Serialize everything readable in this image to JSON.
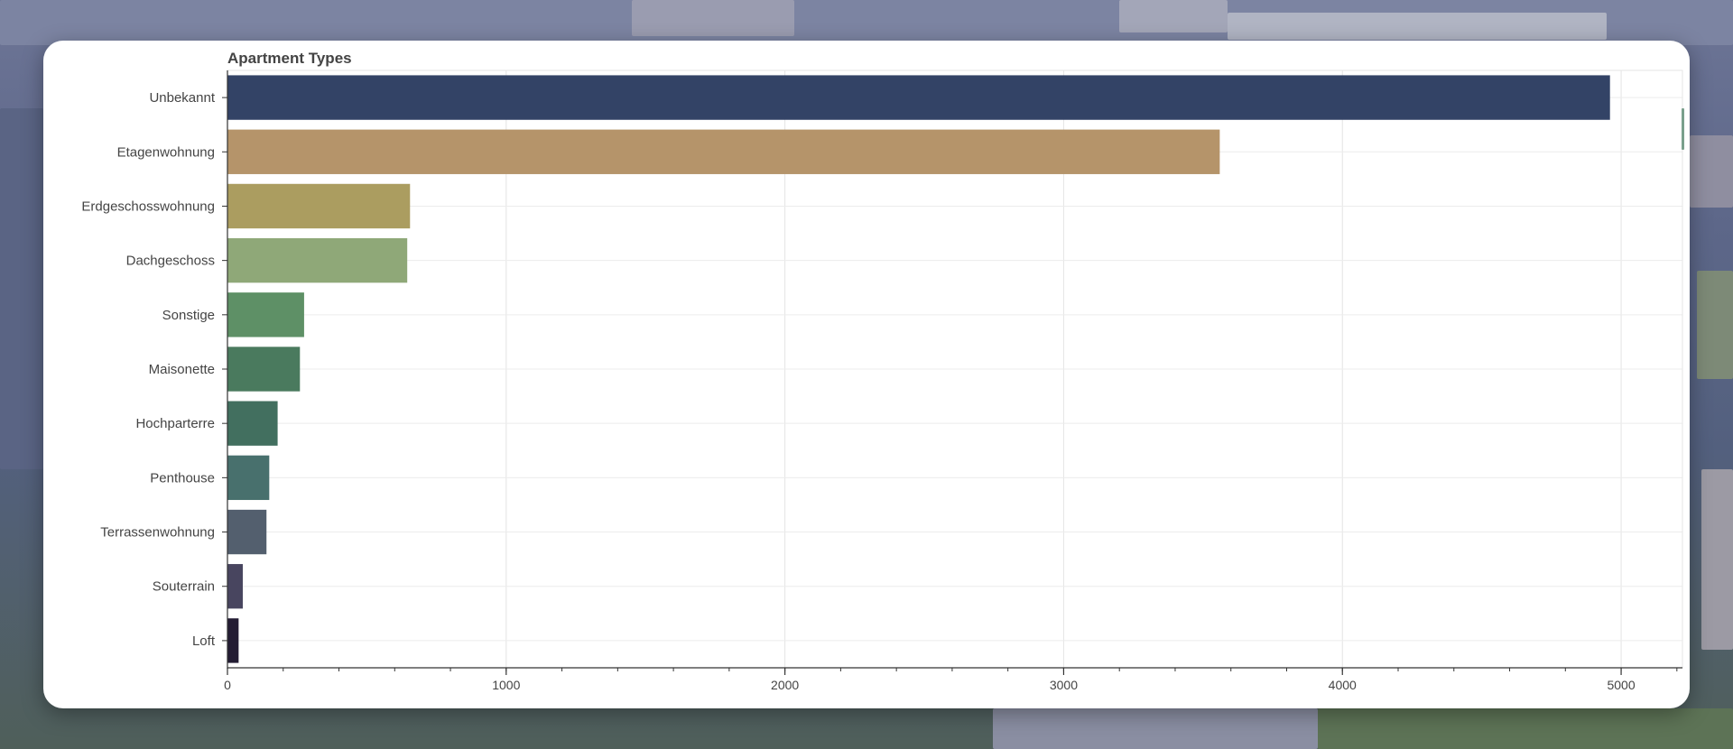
{
  "chart_data": {
    "type": "bar",
    "orientation": "horizontal",
    "title": "Apartment Types",
    "xlabel": "",
    "ylabel": "",
    "categories": [
      "Unbekannt",
      "Etagenwohnung",
      "Erdgeschosswohnung",
      "Dachgeschoss",
      "Sonstige",
      "Maisonette",
      "Hochparterre",
      "Penthouse",
      "Terrassenwohnung",
      "Souterrain",
      "Loft"
    ],
    "values": [
      4960,
      3560,
      655,
      645,
      275,
      260,
      180,
      150,
      140,
      55,
      40
    ],
    "colors": [
      "#334366",
      "#b5946a",
      "#ab9d60",
      "#8fa878",
      "#5e9066",
      "#4a7a5e",
      "#426f5f",
      "#48706d",
      "#535f6e",
      "#48455f",
      "#231c33"
    ],
    "xlim": [
      0,
      5220
    ],
    "xticks": [
      0,
      1000,
      2000,
      3000,
      4000,
      5000
    ],
    "minor_tick_step": 200,
    "grid": true
  }
}
